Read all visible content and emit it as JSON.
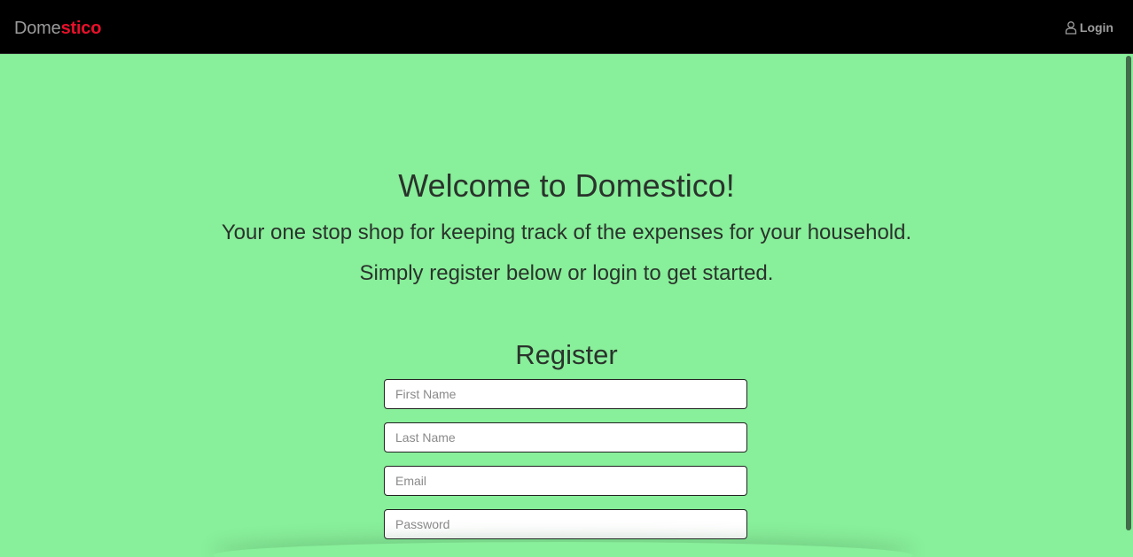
{
  "navbar": {
    "brand_part1": "Dome",
    "brand_part2": "stico",
    "login_label": "Login",
    "login_icon": "user-icon"
  },
  "hero": {
    "title": "Welcome to Domestico!",
    "tagline": "Your one stop shop for keeping track of the expenses for your household.",
    "cta": "Simply register below or login to get started."
  },
  "register": {
    "title": "Register",
    "fields": [
      {
        "placeholder": "First Name",
        "value": ""
      },
      {
        "placeholder": "Last Name",
        "value": ""
      },
      {
        "placeholder": "Email",
        "value": ""
      },
      {
        "placeholder": "Password",
        "value": ""
      }
    ]
  },
  "colors": {
    "background": "#88ef9a",
    "navbar": "#000000",
    "brand_accent": "#e8102a",
    "brand_muted": "#9a9a9a",
    "text": "#2a332c"
  }
}
